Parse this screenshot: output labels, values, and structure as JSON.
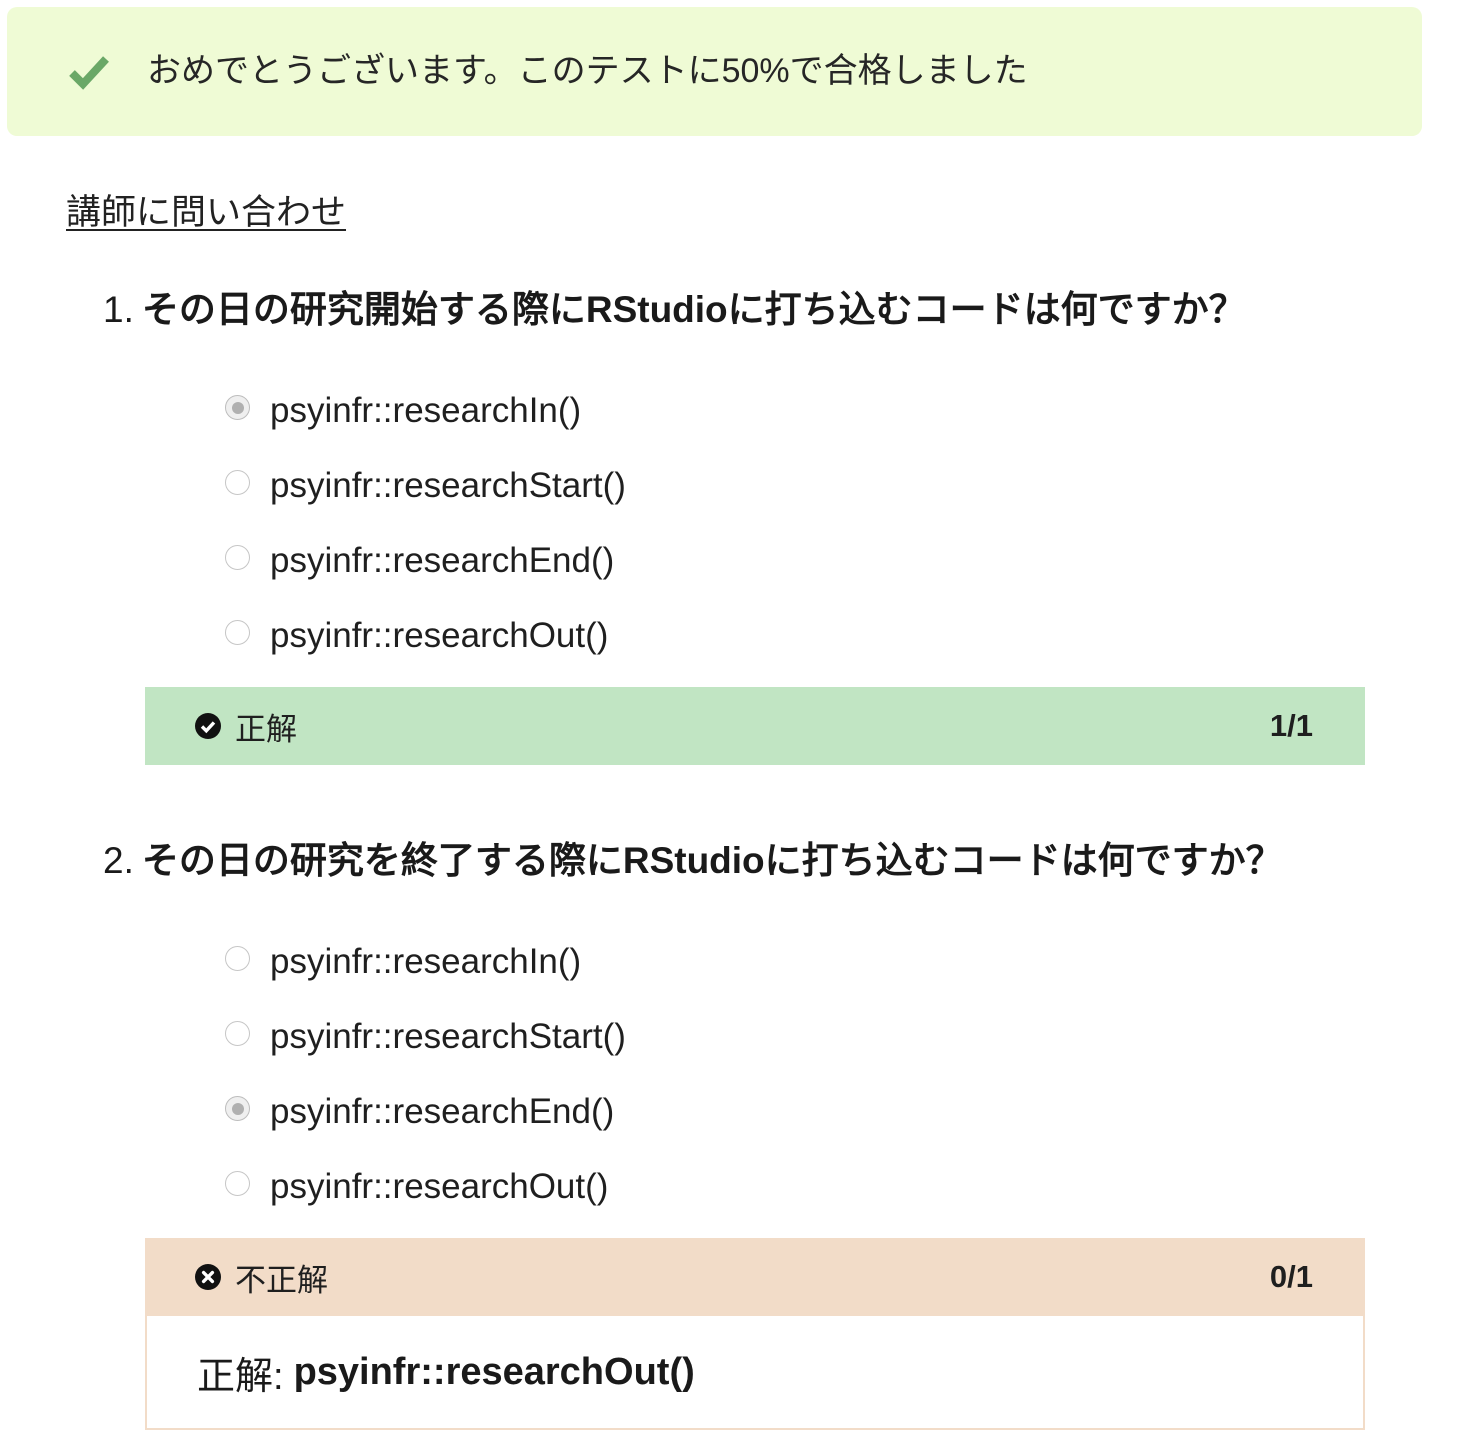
{
  "banner": {
    "icon": "check-icon",
    "message": "おめでとうございます。このテストに50%で合格しました",
    "background": "#effbd5",
    "icon_color": "#6aa867"
  },
  "contact_link": "講師に問い合わせ",
  "questions": [
    {
      "number": "1.",
      "text": "その日の研究開始する際にRStudioに打ち込むコードは何ですか？",
      "options": [
        "psyinfr::researchIn()",
        "psyinfr::researchStart()",
        "psyinfr::researchEnd()",
        "psyinfr::researchOut()"
      ],
      "selected_index": 0,
      "result": {
        "icon": "check-circle-icon",
        "label": "正解",
        "score": "1/1",
        "background": "#c1e5c3"
      }
    },
    {
      "number": "2.",
      "text": "その日の研究を終了する際にRStudioに打ち込むコードは何ですか？",
      "options": [
        "psyinfr::researchIn()",
        "psyinfr::researchStart()",
        "psyinfr::researchEnd()",
        "psyinfr::researchOut()"
      ],
      "selected_index": 2,
      "result": {
        "icon": "x-circle-icon",
        "label": "不正解",
        "score": "0/1",
        "background": "#f2dcc8"
      },
      "correct_answer": {
        "label": "正解:",
        "value": "psyinfr::researchOut()"
      }
    }
  ]
}
